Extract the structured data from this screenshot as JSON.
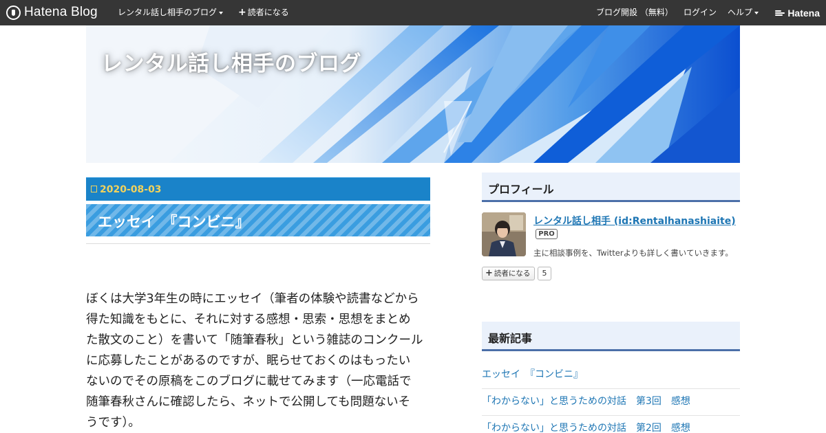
{
  "globalbar": {
    "logo_text": "Hatena Blog",
    "blog_menu_label": "レンタル話し相手のブログ",
    "subscribe_label": "読者になる",
    "open_blog_label": "ブログ開設 （無料）",
    "login_label": "ログイン",
    "help_label": "ヘルプ",
    "hatena_label": "Hatena"
  },
  "header": {
    "blog_title": "レンタル話し相手のブログ"
  },
  "entry": {
    "date": "2020-08-03",
    "title": "エッセイ　『コンビニ』",
    "body_lines": [
      "ぼくは大学3年生の時にエッセイ（筆者の体験や読書などから",
      "得た知識をもとに、それに対する感想・思索・思想をまとめ",
      "た散文のこと）を書いて「随筆春秋」という雑誌のコンクール",
      "に応募したことがあるのですが、眠らせておくのはもったい",
      "ないのでその原稿をこのブログに載せてみます（一応電話で",
      "随筆春秋さんに確認したら、ネットで公開しても問題ないそ",
      "うです）。"
    ]
  },
  "sidebar": {
    "profile": {
      "heading": "プロフィール",
      "name": "レンタル話し相手 (id:Rentalhanashiaite)",
      "badge": "PRO",
      "description": "主に相談事例を、Twitterよりも詳しく書いていきます。",
      "subscribe_label": "読者になる",
      "subscriber_count": "5"
    },
    "recent": {
      "heading": "最新記事",
      "items": [
        "エッセイ　『コンビニ』",
        "「わからない」と思うための対話　第3回　感想",
        "「わからない」と思うための対話　第2回　感想"
      ]
    }
  },
  "colors": {
    "globalbar_bg": "#363636",
    "date_bar_bg": "#1a83c9",
    "date_text": "#f2d25c",
    "title_bar_bg": "#3a9de0",
    "link": "#1e76b4",
    "sidebar_heading_bg": "#eaf1fb",
    "sidebar_heading_border": "#4b6fa8"
  },
  "icons": {
    "logo": "hatena-blog-logo-icon",
    "caret": "caret-down-icon",
    "plus": "plus-icon",
    "calendar": "calendar-icon",
    "hatena": "hatena-logo-icon"
  }
}
